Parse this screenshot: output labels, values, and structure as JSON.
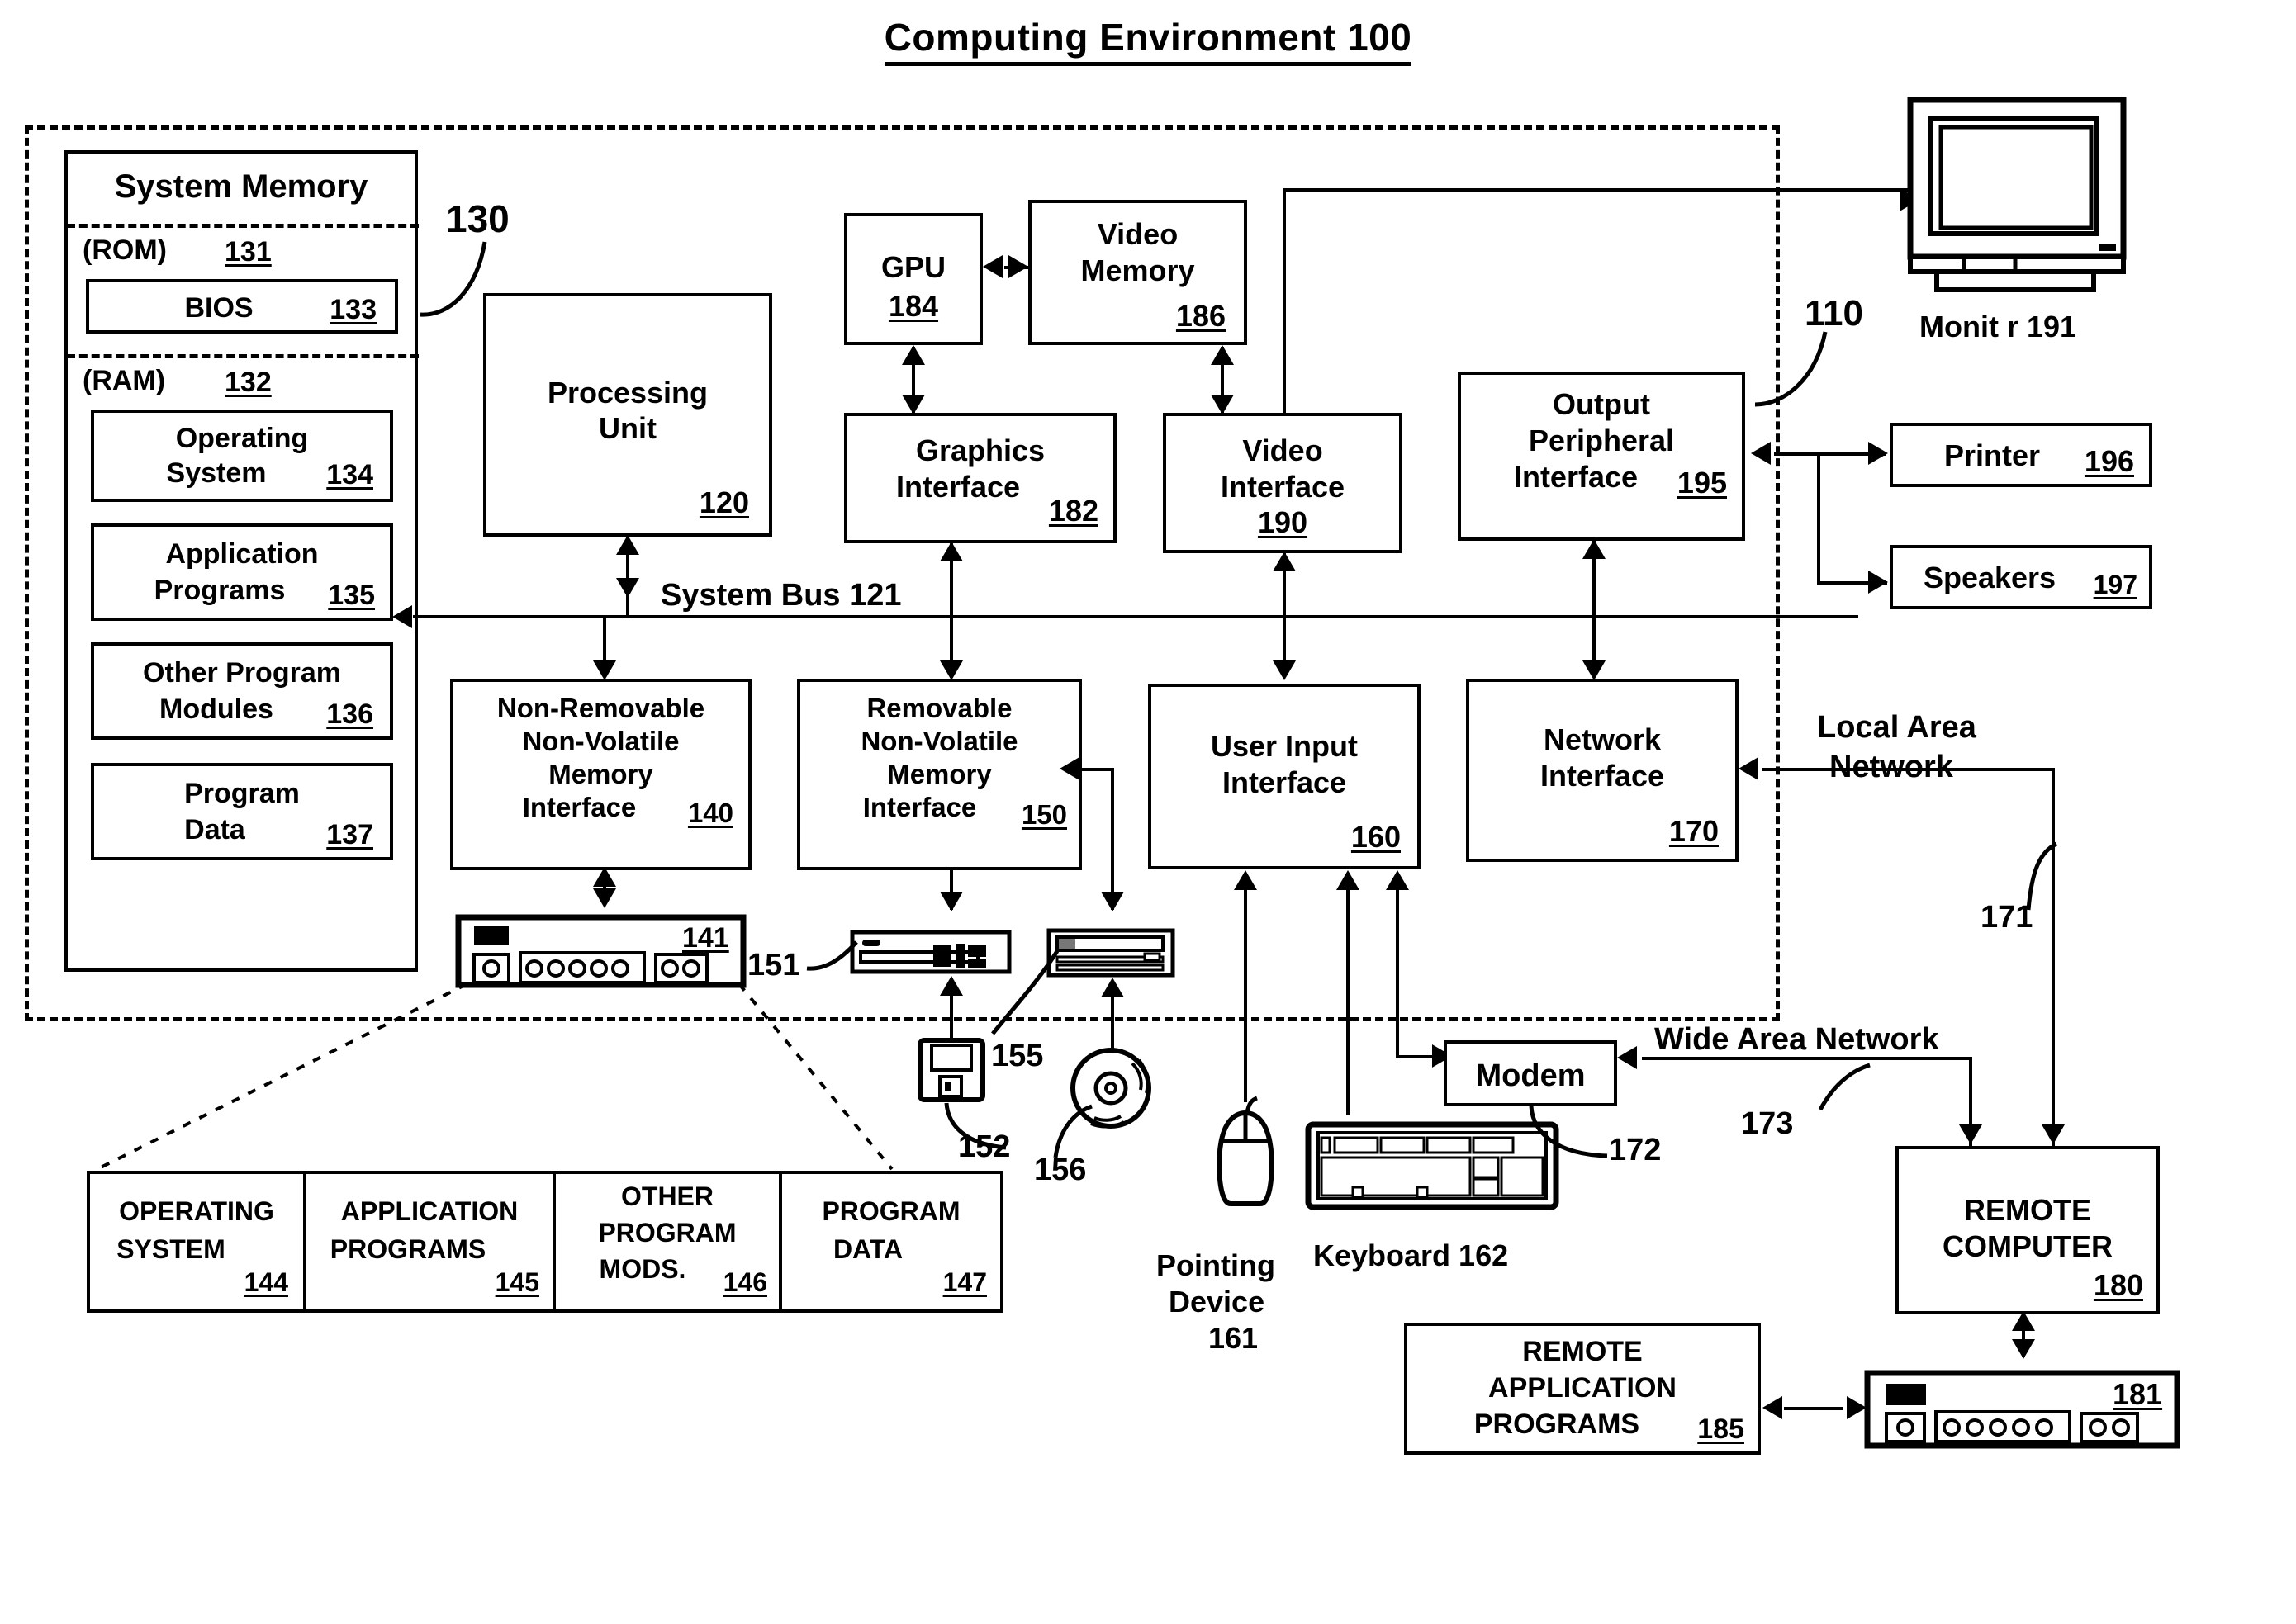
{
  "figure": {
    "title": "Computing Environment 100",
    "outer_ref": "110",
    "inner_ref": "130"
  },
  "system_memory": {
    "header": "System Memory",
    "rom_label": "(ROM)",
    "rom_num": "131",
    "bios_label": "BIOS",
    "bios_num": "133",
    "ram_label": "(RAM)",
    "ram_num": "132",
    "items": [
      {
        "line1": "Operating",
        "line2": "System",
        "num": "134"
      },
      {
        "line1": "Application",
        "line2": "Programs",
        "num": "135"
      },
      {
        "line1": "Other Program",
        "line2": "Modules",
        "num": "136"
      },
      {
        "line1": "Program",
        "line2": "Data",
        "num": "137"
      }
    ]
  },
  "processing_unit": {
    "line1": "Processing",
    "line2": "Unit",
    "num": "120"
  },
  "system_bus": {
    "label": "System Bus 121"
  },
  "graphics": {
    "gpu": {
      "label": "GPU",
      "num": "184"
    },
    "video_memory": {
      "line1": "Video",
      "line2": "Memory",
      "num": "186"
    },
    "graphics_interface": {
      "line1": "Graphics",
      "line2": "Interface",
      "num": "182"
    },
    "video_interface": {
      "line1": "Video",
      "line2": "Interface",
      "num": "190"
    }
  },
  "output_peripheral_interface": {
    "line1": "Output",
    "line2": "Peripheral",
    "line3": "Interface",
    "num": "195"
  },
  "peripherals": {
    "monitor_label": "Monit  r 191",
    "printer": {
      "label": "Printer",
      "num": "196"
    },
    "speakers": {
      "label": "Speakers",
      "num": "197"
    }
  },
  "storage_interfaces": {
    "non_removable": {
      "line1": "Non-Removable",
      "line2": "Non-Volatile",
      "line3": "Memory",
      "line4": "Interface",
      "num": "140"
    },
    "removable": {
      "line1": "Removable",
      "line2": "Non-Volatile",
      "line3": "Memory",
      "line4": "Interface",
      "num": "150"
    }
  },
  "user_input_interface": {
    "line1": "User Input",
    "line2": "Interface",
    "num": "160"
  },
  "network_interface": {
    "line1": "Network",
    "line2": "Interface",
    "num": "170"
  },
  "drives": {
    "hard_disk_num": "141",
    "floppy_drive_ref": "151",
    "floppy_disk_ref": "152",
    "optical_drive_ref": "155",
    "optical_disc_ref": "156"
  },
  "input_devices": {
    "pointing_device_line1": "Pointing",
    "pointing_device_line2": "Device",
    "pointing_device_num": "161",
    "keyboard_label": "Keyboard 162"
  },
  "network": {
    "lan_line1": "Local Area",
    "lan_line2": "Network",
    "lan_ref": "171",
    "wan_label": "Wide Area Network",
    "wan_ref": "173",
    "modem_label": "Modem",
    "modem_ref": "172"
  },
  "remote": {
    "computer_line1": "REMOTE",
    "computer_line2": "COMPUTER",
    "computer_num": "180",
    "computer_hw_num": "181",
    "apps_line1": "REMOTE",
    "apps_line2": "APPLICATION",
    "apps_line3": "PROGRAMS",
    "apps_num": "185"
  },
  "storage_table": {
    "cells": [
      {
        "line1": "OPERATING",
        "line2": "SYSTEM",
        "line3": "",
        "num": "144"
      },
      {
        "line1": "APPLICATION",
        "line2": "PROGRAMS",
        "line3": "",
        "num": "145"
      },
      {
        "line1": "OTHER",
        "line2": "PROGRAM",
        "line3": "MODS.",
        "num": "146"
      },
      {
        "line1": "PROGRAM",
        "line2": "DATA",
        "line3": "",
        "num": "147"
      }
    ]
  },
  "colors": {
    "ink": "#000000",
    "paper": "#ffffff"
  }
}
